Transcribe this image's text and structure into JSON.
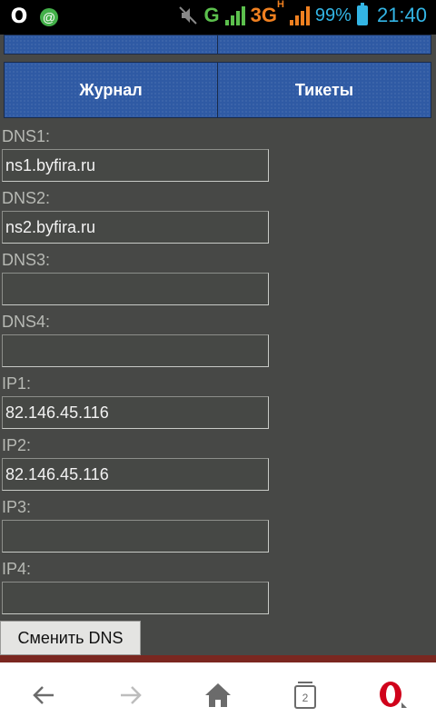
{
  "status_bar": {
    "time": "21:40",
    "battery_percent": "99%",
    "network_g": "G",
    "network_3g": "3G",
    "network_3g_sup": "H",
    "opera_glyph": "O",
    "whatsapp_glyph": "@"
  },
  "nav": {
    "top_row": [
      "",
      ""
    ],
    "journal_label": "Журнал",
    "tickets_label": "Тикеты"
  },
  "form": {
    "fields": [
      {
        "label": "DNS1:",
        "value": "ns1.byfira.ru"
      },
      {
        "label": "DNS2:",
        "value": "ns2.byfira.ru"
      },
      {
        "label": "DNS3:",
        "value": ""
      },
      {
        "label": "DNS4:",
        "value": ""
      },
      {
        "label": "IP1:",
        "value": "82.146.45.116"
      },
      {
        "label": "IP2:",
        "value": "82.146.45.116"
      },
      {
        "label": "IP3:",
        "value": ""
      },
      {
        "label": "IP4:",
        "value": ""
      }
    ],
    "submit_label": "Сменить DNS"
  },
  "toolbar": {
    "tabs_count": "2",
    "icons": [
      "back-arrow-icon",
      "forward-arrow-icon",
      "home-icon",
      "tabs-icon",
      "opera-menu-icon"
    ]
  },
  "colors": {
    "page_bg": "#474846",
    "nav_button_bg": "#2f5aa4",
    "status_accent": "#33b5e5",
    "signal_green": "#5cc04d",
    "network_orange": "#f08020",
    "opera_red": "#d0021b"
  }
}
